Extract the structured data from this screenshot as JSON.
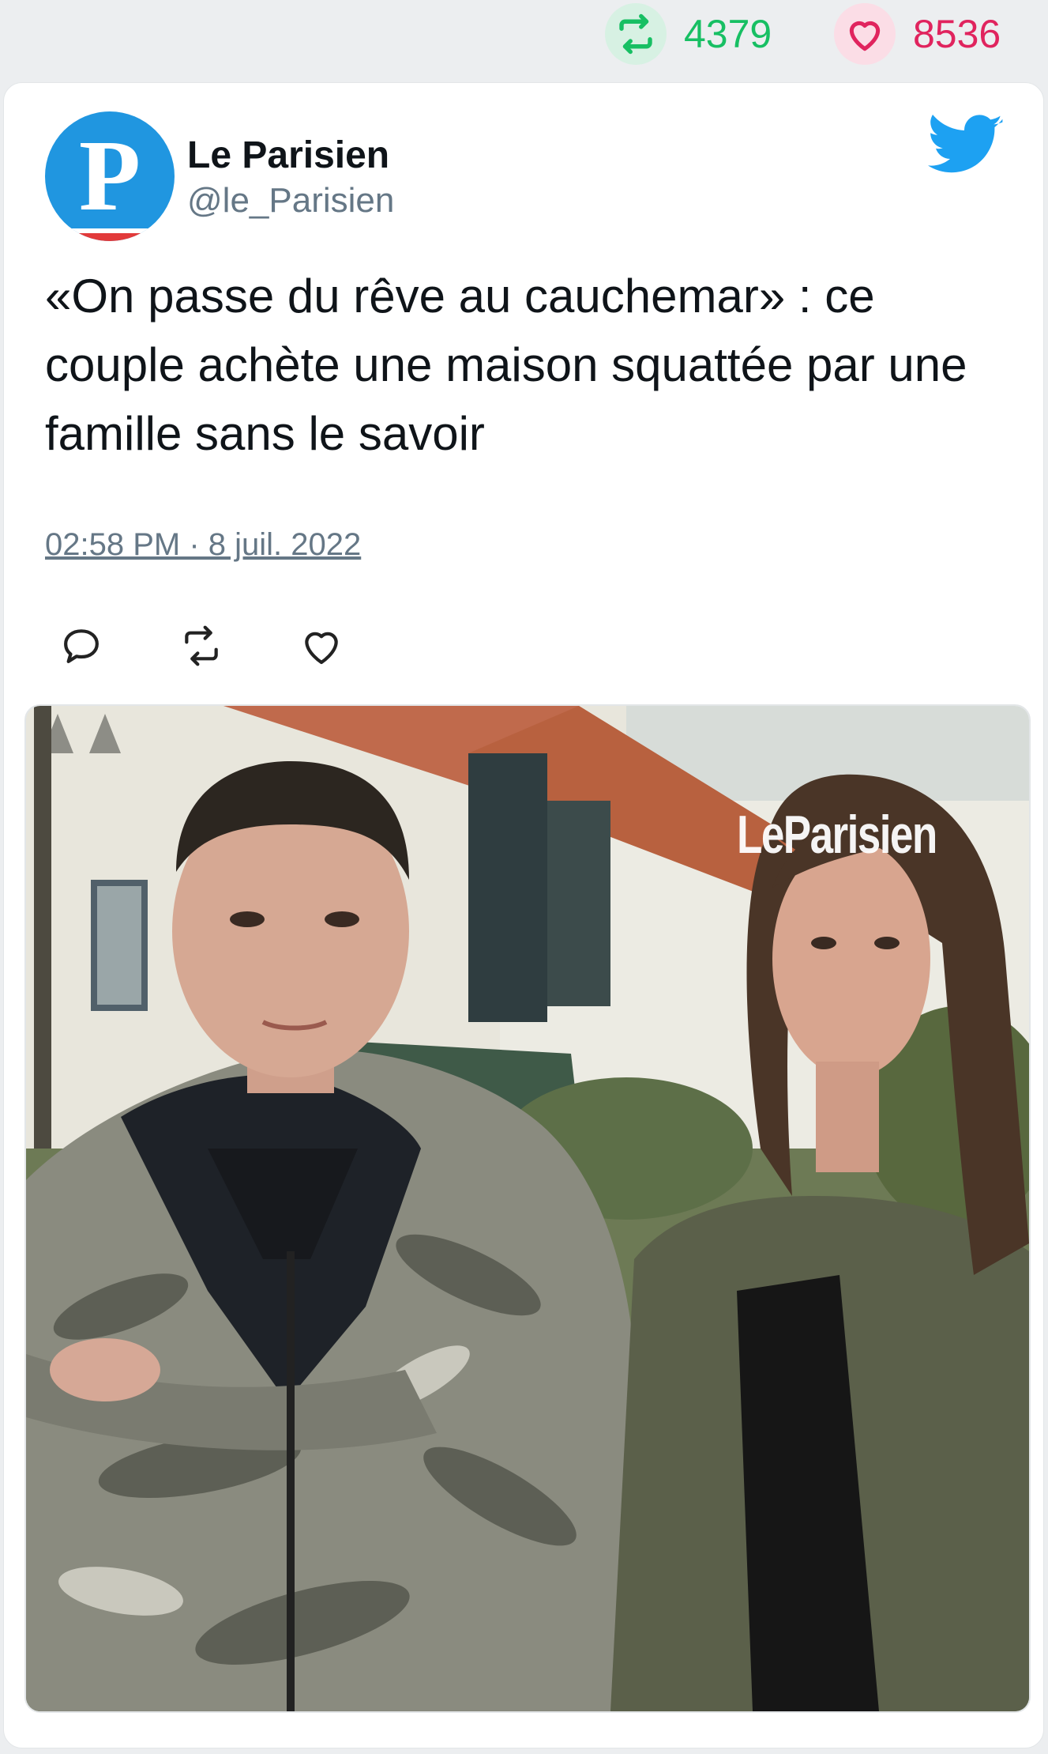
{
  "stats": {
    "retweets": "4379",
    "likes": "8536",
    "retweet_icon": "retweet-icon",
    "like_icon": "heart-icon",
    "retweet_color": "#17bf63",
    "like_color": "#e0245e"
  },
  "tweet": {
    "author_name": "Le Parisien",
    "author_handle": "@le_Parisien",
    "avatar_letter": "P",
    "text": "«On passe du rêve au cauchemar» : ce couple achète une maison squattée par une famille sans le savoir",
    "timestamp": "02:58 PM · 8 juil. 2022",
    "brand_icon": "twitter-bird-icon",
    "brand_color": "#1da1f2"
  },
  "actions": [
    {
      "icon": "reply-icon"
    },
    {
      "icon": "retweet-icon"
    },
    {
      "icon": "like-icon"
    }
  ],
  "media": {
    "watermark": "LeParisien"
  }
}
